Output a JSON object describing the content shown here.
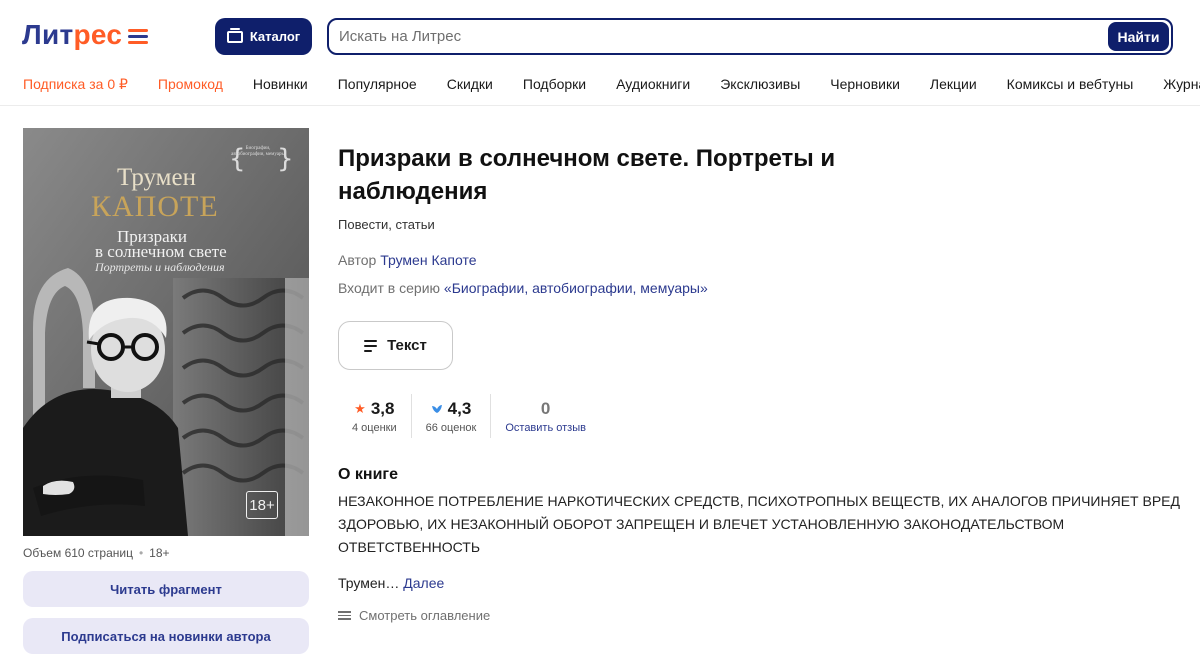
{
  "header": {
    "logo_part1": "Лит",
    "logo_part2": "рес",
    "catalog_label": "Каталог",
    "search_placeholder": "Искать на Литрес",
    "search_button": "Найти"
  },
  "nav": [
    {
      "label": "Подписка за 0 ₽",
      "accent": true
    },
    {
      "label": "Промокод",
      "accent": true
    },
    {
      "label": "Новинки",
      "accent": false
    },
    {
      "label": "Популярное",
      "accent": false
    },
    {
      "label": "Скидки",
      "accent": false
    },
    {
      "label": "Подборки",
      "accent": false
    },
    {
      "label": "Аудиокниги",
      "accent": false
    },
    {
      "label": "Эксклюзивы",
      "accent": false
    },
    {
      "label": "Черновики",
      "accent": false
    },
    {
      "label": "Лекции",
      "accent": false
    },
    {
      "label": "Комиксы и вебтуны",
      "accent": false
    },
    {
      "label": "Журналы",
      "accent": false
    }
  ],
  "cover": {
    "author_first": "Трумен",
    "author_last": "КАПОТЕ",
    "title_line1": "Призраки",
    "title_line2": "в солнечном свете",
    "subtitle": "Портреты и наблюдения",
    "series_text": "Биографии, автобиографии, мемуары",
    "age_badge": "18+"
  },
  "book": {
    "title": "Призраки в солнечном свете. Портреты и наблюдения",
    "genre": "Повести, статьи",
    "author_prefix": "Автор",
    "author_name": "Трумен Капоте",
    "series_prefix": "Входит в серию",
    "series_name": "«Биографии, автобиографии, мемуары»",
    "format_button": "Текст",
    "volume": "Объем 610 страниц",
    "age": "18+",
    "read_fragment": "Читать фрагмент",
    "subscribe_author": "Подписаться на новинки автора"
  },
  "ratings": {
    "litres_value": "3,8",
    "litres_count": "4 оценки",
    "livelib_value": "4,3",
    "livelib_count": "66 оценок",
    "reviews_value": "0",
    "reviews_link": "Оставить отзыв"
  },
  "about": {
    "heading": "О книге",
    "text": "НЕЗАКОННОЕ ПОТРЕБЛЕНИЕ НАРКОТИЧЕСКИХ СРЕДСТВ, ПСИХОТРОПНЫХ ВЕЩЕСТВ, ИХ АНАЛОГОВ ПРИЧИНЯЕТ ВРЕД ЗДОРОВЬЮ, ИХ НЕЗАКОННЫЙ ОБОРОТ ЗАПРЕЩЕН И ВЛЕЧЕТ УСТАНОВЛЕННУЮ ЗАКОНОДАТЕЛЬСТВОМ ОТВЕТСТВЕННОСТЬ",
    "teaser": "Трумен…",
    "more_link": "Далее",
    "toc_link": "Смотреть оглавление"
  },
  "colors": {
    "brand_navy": "#0f1f6b",
    "brand_orange": "#ff5c26",
    "link_blue": "#2c3a8f",
    "button_lavender": "#e9e8f6"
  }
}
